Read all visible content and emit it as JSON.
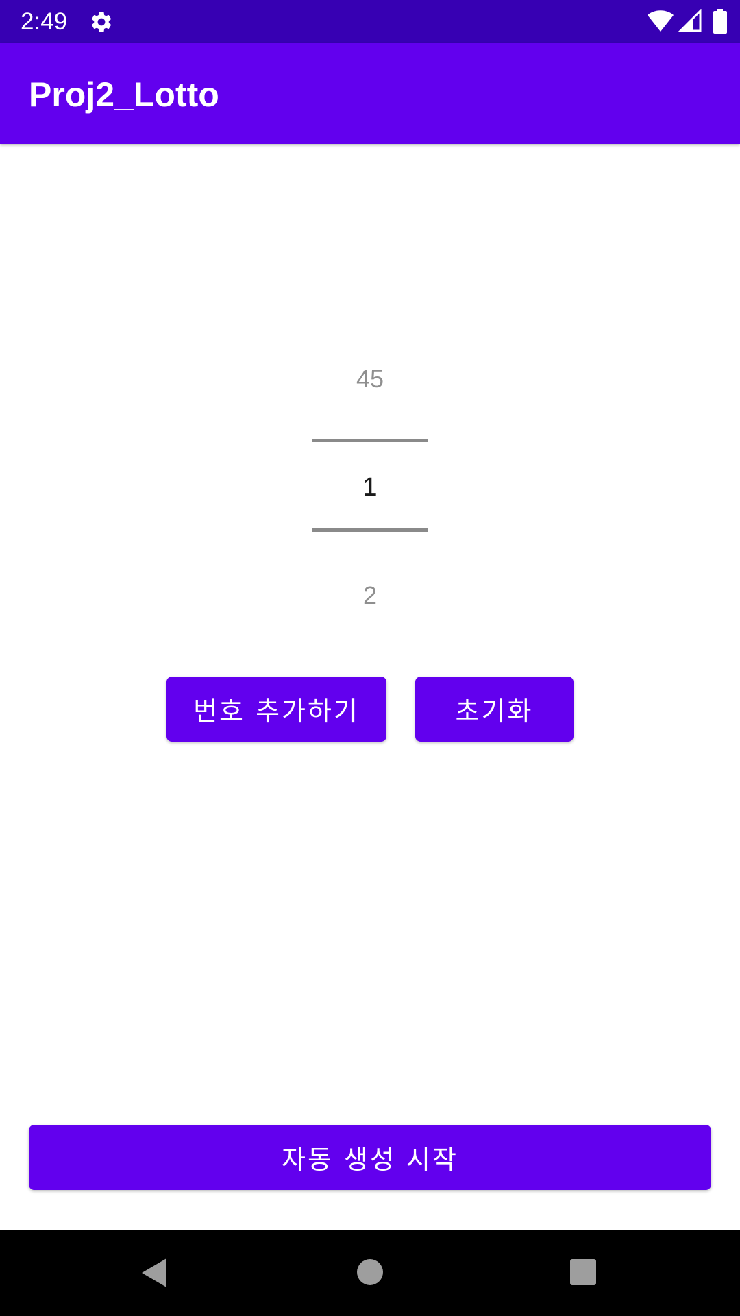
{
  "status_bar": {
    "time": "2:49",
    "icons": [
      "gear-icon",
      "wifi-icon",
      "signal-icon",
      "battery-icon"
    ],
    "background": "#3700B3"
  },
  "app_bar": {
    "title": "Proj2_Lotto",
    "background": "#6200EE"
  },
  "number_picker": {
    "previous_value": "45",
    "current_value": "1",
    "next_value": "2"
  },
  "buttons": {
    "add_number": "번호 추가하기",
    "reset": "초기화",
    "auto_generate": "자동 생성 시작",
    "color": "#6200EE"
  },
  "navigation_bar": {
    "icons": [
      "back-icon",
      "home-icon",
      "recents-icon"
    ]
  }
}
